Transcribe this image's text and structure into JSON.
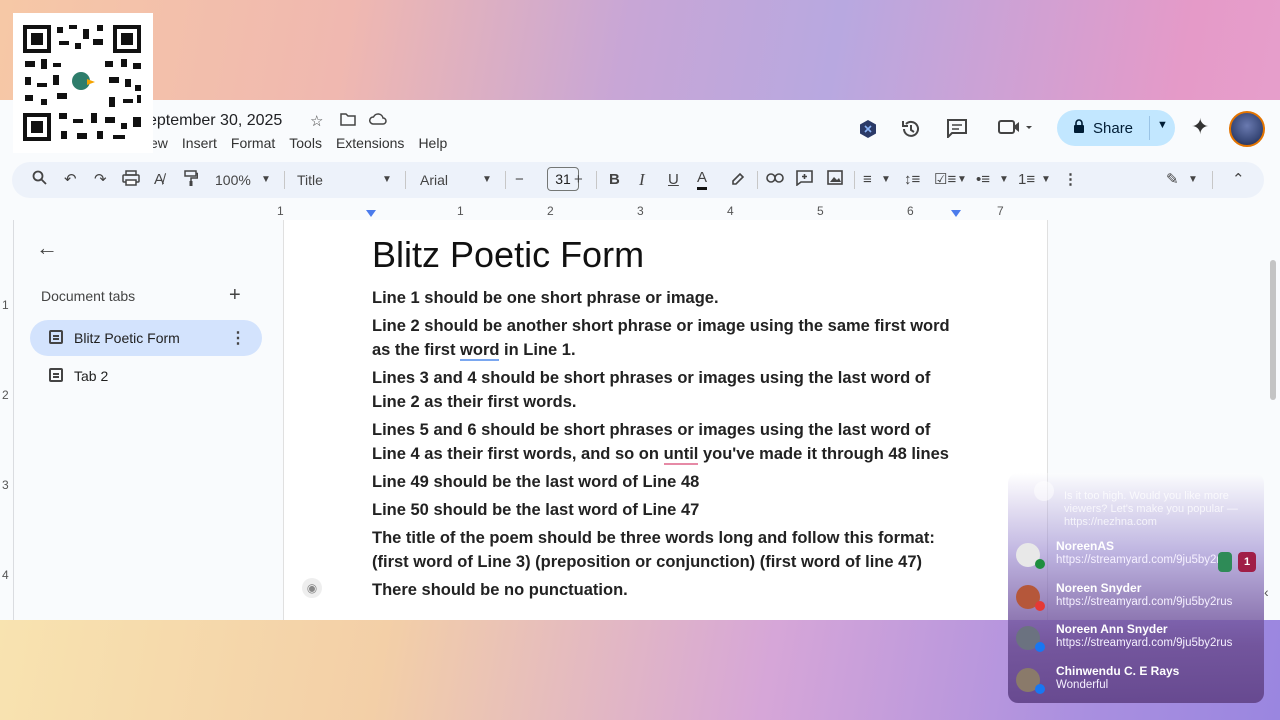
{
  "header": {
    "doc_title": "eptember 30, 2025",
    "menus": [
      "ew",
      "Insert",
      "Format",
      "Tools",
      "Extensions",
      "Help"
    ],
    "share_label": "Share"
  },
  "toolbar": {
    "zoom": "100%",
    "style": "Title",
    "font": "Arial",
    "font_size": "31"
  },
  "ruler": [
    "1",
    "1",
    "2",
    "3",
    "4",
    "5",
    "6",
    "7"
  ],
  "v_ruler": [
    "1",
    "2",
    "3",
    "4"
  ],
  "sidebar": {
    "label": "Document tabs",
    "tabs": [
      {
        "label": "Blitz Poetic Form"
      },
      {
        "label": "Tab 2"
      }
    ]
  },
  "document": {
    "heading": "Blitz Poetic Form",
    "p1": "Line 1 should be one short phrase or image.",
    "p2a": "Line 2 should be another short phrase or image using the same first word",
    "p2b_pre": "as the first ",
    "p2b_word": "word",
    "p2b_post": " in Line 1.",
    "p3a": "Lines 3 and 4 should be short phrases or images using the last word of",
    "p3b": "Line 2 as their first words.",
    "p4a": "Lines 5 and 6 should be short phrases or images using the last word of",
    "p4b_pre": "Line 4 as their first words, and so on ",
    "p4b_word": "until",
    "p4b_post": " you've made it through 48 lines",
    "p5": "Line 49 should be the last word of Line 48",
    "p6": "Line 50 should be the last word of Line 47",
    "p7a": "The title of the poem should be three words long and follow this format:",
    "p7b": "(first word of Line 3) (preposition or conjunction) (first word of line 47)",
    "p8": "There should be no punctuation."
  },
  "chat": {
    "spam": "Is it too high. Would you like more viewers? Let's make you popular — https://nezhna.com",
    "messages": [
      {
        "name": "NoreenAS",
        "text": "https://streamyard.com/9ju5by2rus",
        "avatar_color": "#e8e8e8",
        "badge_color": "#1e8e3e"
      },
      {
        "name": "Noreen Snyder",
        "text": "https://streamyard.com/9ju5by2rus",
        "avatar_color": "#b5573a",
        "badge_color": "#e53935"
      },
      {
        "name": "Noreen Ann Snyder",
        "text": "https://streamyard.com/9ju5by2rus",
        "avatar_color": "#6b7280",
        "badge_color": "#1877f2"
      },
      {
        "name": "Chinwendu C. E Rays",
        "text": "Wonderful",
        "avatar_color": "#8a7a6a",
        "badge_color": "#1877f2"
      }
    ],
    "count_badge": "1"
  }
}
